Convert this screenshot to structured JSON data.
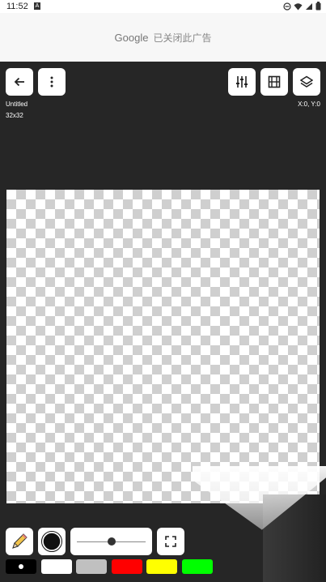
{
  "status": {
    "time": "11:52",
    "notification_glyph": "A",
    "icons": [
      "dnd-icon",
      "wifi-icon",
      "signal-icon",
      "battery-icon"
    ]
  },
  "ad": {
    "brand": "Google",
    "message": "已关闭此广告"
  },
  "toolbar": {
    "back_icon": "arrow-left-icon",
    "more_icon": "more-vert-icon",
    "adjust_icon": "sliders-icon",
    "frames_icon": "film-icon",
    "layers_icon": "layers-icon"
  },
  "document": {
    "name": "Untitled",
    "size": "32x32",
    "coords": "X:0, Y:0"
  },
  "tools": {
    "pencil_icon": "pencil-icon",
    "brush_icon": "brush-shape-icon",
    "brush_size_level": 0.5,
    "fullscreen_icon": "fullscreen-icon"
  },
  "palette": {
    "colors": [
      "#000000",
      "#ffffff",
      "#c0c0c0",
      "#ff0000",
      "#ffff00",
      "#00ff00"
    ],
    "selected_index": 0
  }
}
